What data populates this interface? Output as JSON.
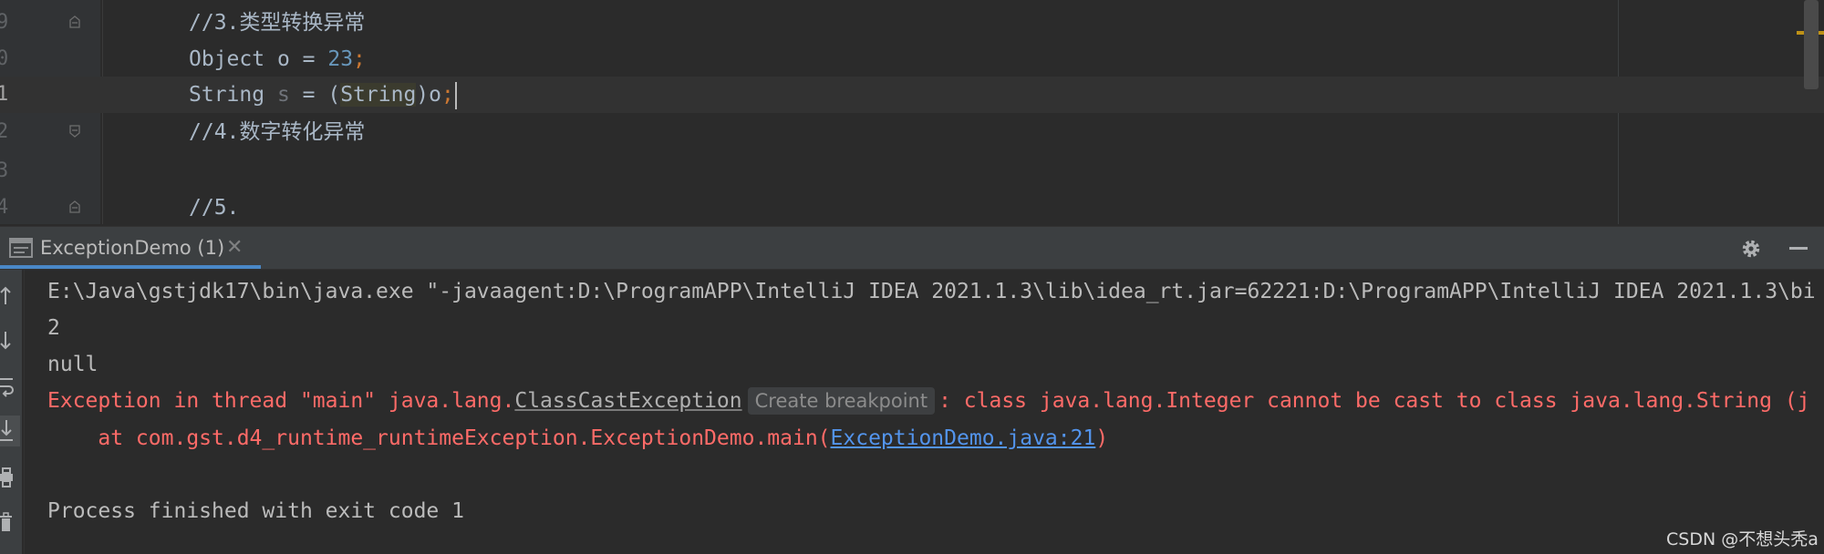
{
  "editor": {
    "lines": [
      {
        "no": "9",
        "comment": "//3.类型转换异常"
      },
      {
        "no": "0",
        "kw1": "Object",
        "mid": " o = ",
        "num": "23",
        "semi": ";"
      },
      {
        "no": "1",
        "kw1": "String",
        "sp": " ",
        "var": "s",
        "mid": " = (",
        "cast": "String",
        "tail": ")o",
        "semi": ";"
      },
      {
        "no": "2",
        "comment": "//4.数字转化异常"
      },
      {
        "no": "3"
      },
      {
        "no": "4",
        "comment": "//5."
      }
    ]
  },
  "tool_window": {
    "tab_label": "ExceptionDemo (1)",
    "tab_close": "✕"
  },
  "console": {
    "cmd": "E:\\Java\\gstjdk17\\bin\\java.exe \"-javaagent:D:\\ProgramAPP\\IntelliJ IDEA 2021.1.3\\lib\\idea_rt.jar=62221:D:\\ProgramAPP\\IntelliJ IDEA 2021.1.3\\bi",
    "out1": "2",
    "out2": "null",
    "exc_prefix": "Exception in thread \"main\" java.lang.",
    "exc_class": "ClassCastException",
    "breakpoint_hint": "Create breakpoint",
    "exc_suffix": ": class java.lang.Integer cannot be cast to class java.lang.String (j",
    "trace_prefix": "    at com.gst.d4_runtime_runtimeException.ExceptionDemo.main(",
    "trace_link": "ExceptionDemo.java:21",
    "trace_suffix": ")",
    "exit": "Process finished with exit code 1"
  },
  "watermark": "CSDN @不想头秃a",
  "icons": {
    "fold": "fold-marker-icon",
    "run_tab": "console-tab-icon",
    "settings": "gear-icon",
    "minimize": "minimize-icon",
    "toolbar": [
      "arrow-up-icon",
      "arrow-down-icon",
      "soft-wrap-icon",
      "scroll-to-end-icon",
      "print-icon",
      "trash-icon"
    ]
  },
  "colors": {
    "editor_bg": "#2b2b2b",
    "error": "#ff6b68",
    "link": "#5394ec",
    "number": "#6897bb",
    "keyword": "#cc7832",
    "accent": "#4a88c7"
  }
}
